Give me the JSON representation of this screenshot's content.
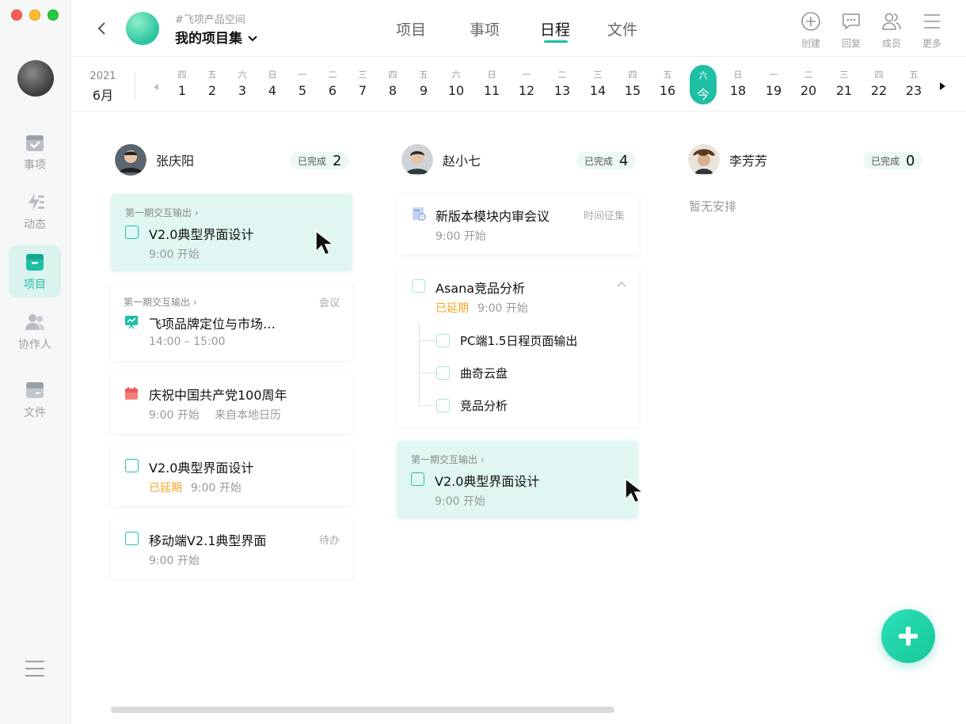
{
  "window": {
    "controls": [
      "close",
      "minimize",
      "maximize"
    ]
  },
  "sidebar": {
    "items": [
      {
        "label": "事项",
        "icon": "calendar-check-icon"
      },
      {
        "label": "动态",
        "icon": "activity-icon"
      },
      {
        "label": "项目",
        "icon": "project-box-icon",
        "active": true
      },
      {
        "label": "协作人",
        "icon": "people-icon"
      },
      {
        "label": "文件",
        "icon": "file-tray-icon"
      }
    ]
  },
  "header": {
    "space": "#飞项产品空间",
    "project": "我的项目集",
    "tabs": [
      "项目",
      "事项",
      "日程",
      "文件"
    ],
    "active_tab": "日程",
    "actions": [
      {
        "label": "创建",
        "icon": "plus-circle-icon"
      },
      {
        "label": "回复",
        "icon": "chat-bubble-icon"
      },
      {
        "label": "成员",
        "icon": "members-icon"
      },
      {
        "label": "更多",
        "icon": "hamburger-icon"
      }
    ]
  },
  "datebar": {
    "year": "2021",
    "month": "6月",
    "days": [
      {
        "wd": "四",
        "d": "1"
      },
      {
        "wd": "五",
        "d": "2"
      },
      {
        "wd": "六",
        "d": "3"
      },
      {
        "wd": "日",
        "d": "4"
      },
      {
        "wd": "一",
        "d": "5"
      },
      {
        "wd": "二",
        "d": "6"
      },
      {
        "wd": "三",
        "d": "7"
      },
      {
        "wd": "四",
        "d": "8"
      },
      {
        "wd": "五",
        "d": "9"
      },
      {
        "wd": "六",
        "d": "10"
      },
      {
        "wd": "日",
        "d": "11"
      },
      {
        "wd": "一",
        "d": "12"
      },
      {
        "wd": "二",
        "d": "13"
      },
      {
        "wd": "三",
        "d": "14"
      },
      {
        "wd": "四",
        "d": "15"
      },
      {
        "wd": "五",
        "d": "16"
      },
      {
        "wd": "六",
        "d": "今",
        "today": true
      },
      {
        "wd": "日",
        "d": "18"
      },
      {
        "wd": "一",
        "d": "19"
      },
      {
        "wd": "二",
        "d": "20"
      },
      {
        "wd": "三",
        "d": "21"
      },
      {
        "wd": "四",
        "d": "22"
      },
      {
        "wd": "五",
        "d": "23"
      }
    ]
  },
  "columns": [
    {
      "name": "张庆阳",
      "done_label": "已完成",
      "done_count": "2",
      "cards": [
        {
          "context": "第一期交互输出 ›",
          "title": "V2.0典型界面设计",
          "sub": "9:00 开始"
        },
        {
          "context": "第一期交互输出 ›",
          "title": "飞项品牌定位与市场…",
          "sub": "14:00 – 15:00",
          "tag": "会议"
        },
        {
          "title": "庆祝中国共产党100周年",
          "sub": "9:00 开始",
          "sub2": "来自本地日历"
        },
        {
          "title": "V2.0典型界面设计",
          "late": "已延期",
          "sub": "9:00 开始"
        },
        {
          "title": "移动端V2.1典型界面",
          "sub": "9:00 开始",
          "tag": "待办"
        }
      ]
    },
    {
      "name": "赵小七",
      "done_label": "已完成",
      "done_count": "4",
      "cards": [
        {
          "title": "新版本模块内审会议",
          "sub": "9:00 开始",
          "tag": "时间征集"
        },
        {
          "title": "Asana竞品分析",
          "late": "已延期",
          "sub": "9:00 开始",
          "children": [
            "PC端1.5日程页面输出",
            "曲奇云盘",
            "竞品分析"
          ]
        },
        {
          "context": "第一期交互输出 ›",
          "title": "V2.0典型界面设计",
          "sub": "9:00 开始"
        }
      ]
    },
    {
      "name": "李芳芳",
      "done_label": "已完成",
      "done_count": "0",
      "empty": "暂无安排"
    }
  ],
  "colors": {
    "accent": "#1fbfa6",
    "late": "#f5a623",
    "highlight": "#e0f6f3"
  }
}
